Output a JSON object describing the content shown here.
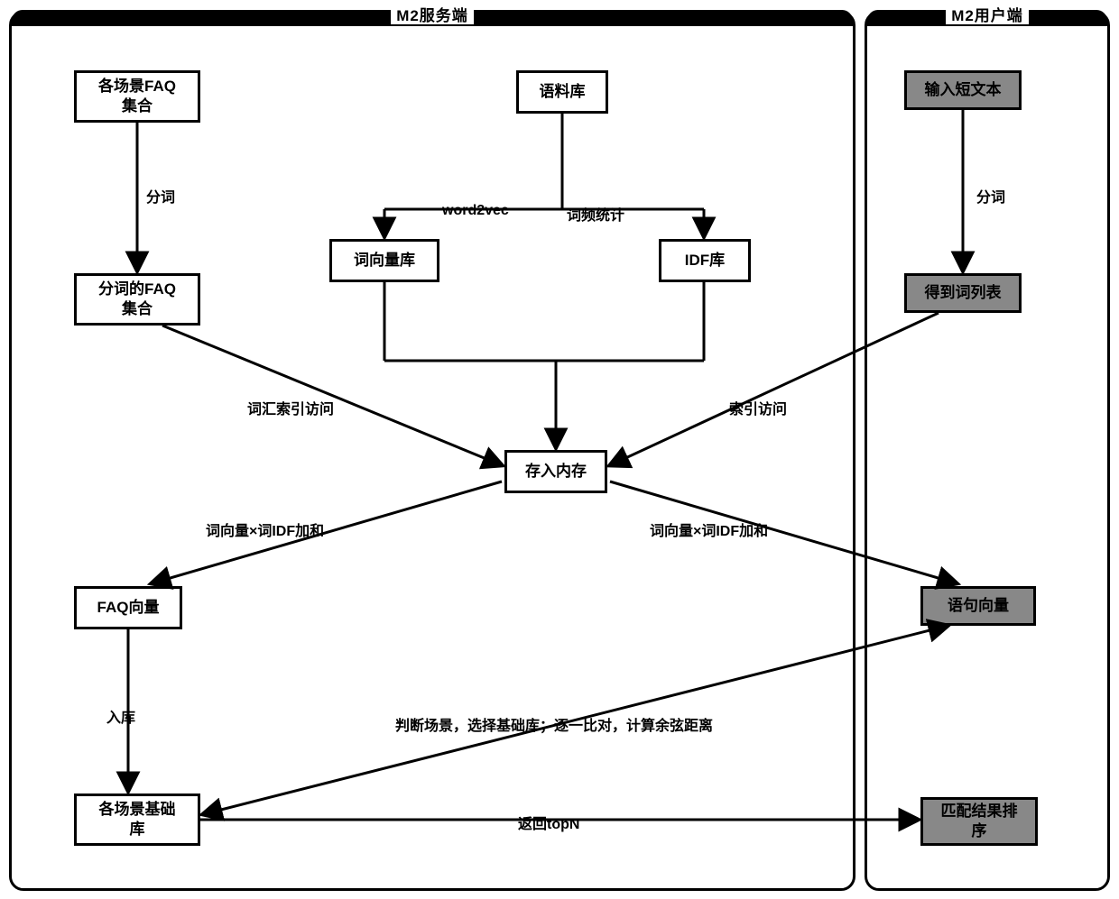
{
  "panels": {
    "server": {
      "title": "M2服务端"
    },
    "client": {
      "title": "M2用户端"
    }
  },
  "nodes": {
    "faq_scenes": "各场景FAQ\n集合",
    "corpus": "语料库",
    "input_text": "输入短文本",
    "faq_seg": "分词的FAQ\n集合",
    "wordvec_lib": "词向量库",
    "idf_lib": "IDF库",
    "word_list": "得到词列表",
    "memory": "存入内存",
    "faq_vector": "FAQ向量",
    "sent_vector": "语句向量",
    "base_lib": "各场景基础\n库",
    "match_rank": "匹配结果排\n序"
  },
  "labels": {
    "seg1": "分词",
    "seg2": "分词",
    "w2v": "word2vec",
    "wordfreq": "词频统计",
    "idx_access1": "词汇索引访问",
    "idx_access2": "索引访问",
    "wv_idf1": "词向量×词IDF加和",
    "wv_idf2": "词向量×词IDF加和",
    "store": "入库",
    "judge": "判断场景，选择基础库；逐一比对，计算余弦距离",
    "return_topn": "返回topN"
  }
}
